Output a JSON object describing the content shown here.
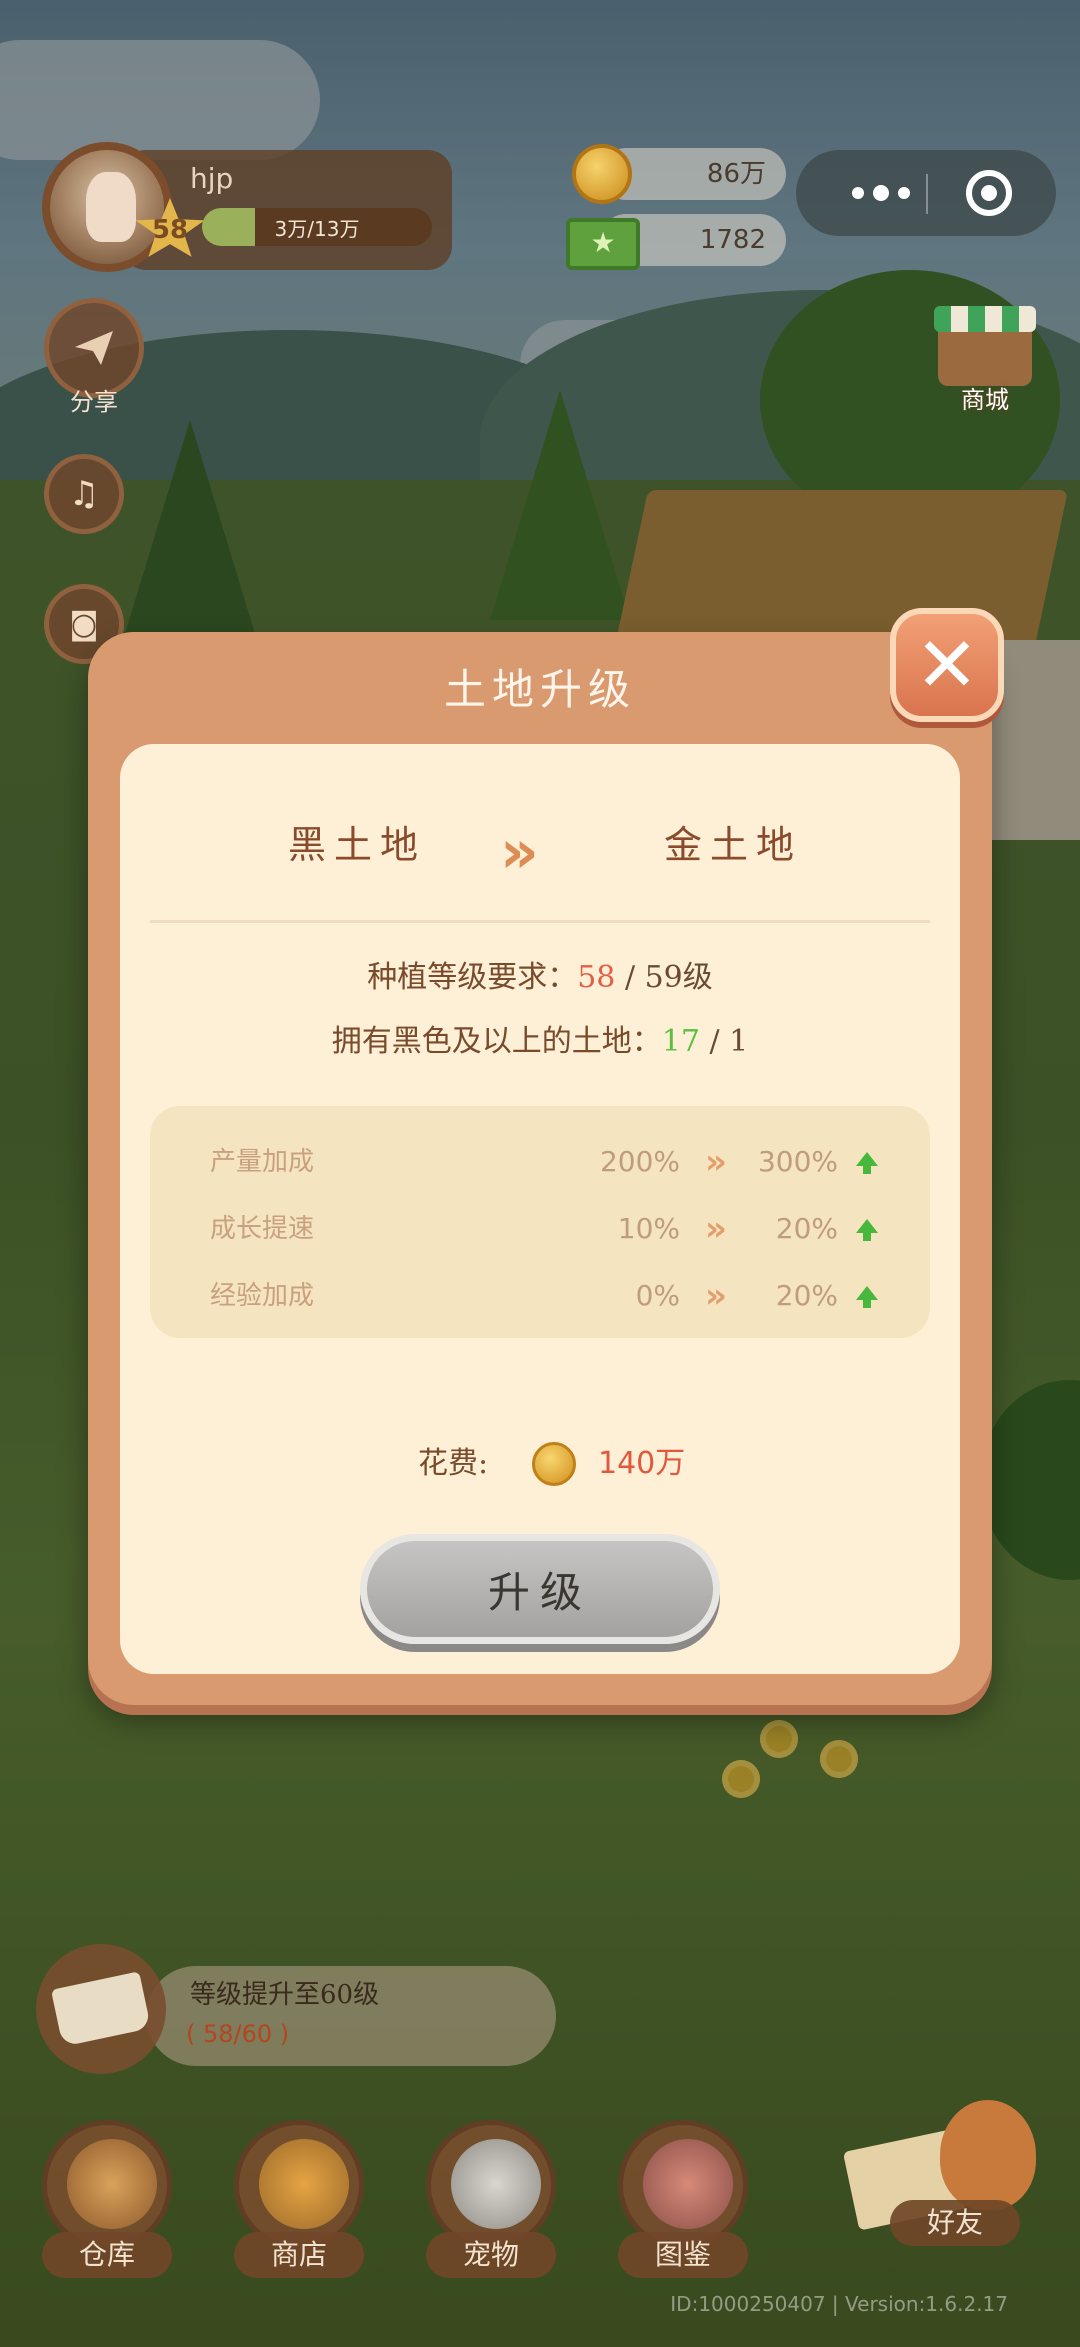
{
  "player": {
    "name": "hjp",
    "level": "58",
    "exp_text": "3万/13万",
    "exp_fraction": 0.23
  },
  "currency": {
    "coins": "86万",
    "cash": "1782"
  },
  "side_buttons": {
    "share_label": "分享",
    "shop_label": "商城"
  },
  "modal": {
    "title": "土地升级",
    "from_land": "黑土地",
    "to_land": "金土地",
    "requirements": {
      "level_label": "种植等级要求：",
      "level_current": "58",
      "level_required": "/ 59级",
      "land_label": "拥有黑色及以上的土地：",
      "land_current": "17",
      "land_required": "/  1"
    },
    "bonuses": [
      {
        "label": "产量加成",
        "from": "200%",
        "to": "300%"
      },
      {
        "label": "成长提速",
        "from": "10%",
        "to": "20%"
      },
      {
        "label": "经验加成",
        "from": "0%",
        "to": "20%"
      }
    ],
    "cost_label": "花费:",
    "cost_value": "140万",
    "upgrade_label": "升级",
    "close_glyph": "✕"
  },
  "quest": {
    "title": "等级提升至60级",
    "progress": "( 58/60 )"
  },
  "nav": {
    "warehouse": "仓库",
    "store": "商店",
    "pet": "宠物",
    "collection": "图鉴",
    "friends": "好友"
  },
  "footer": {
    "version": "ID:1000250407 | Version:1.6.2.17"
  },
  "colors": {
    "accent_red": "#e2604a",
    "accent_green": "#5fbd42",
    "modal_frame": "#d99a70",
    "modal_body": "#fdf0d6"
  }
}
